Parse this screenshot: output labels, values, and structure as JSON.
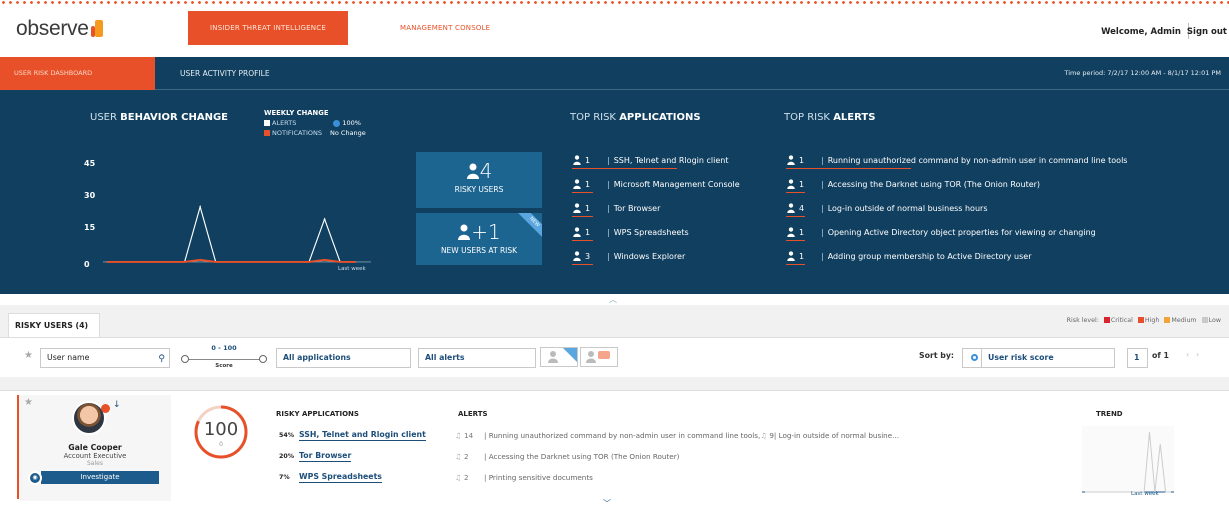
{
  "header": {
    "logo_text": "observe",
    "nav_active": "INSIDER THREAT INTELLIGENCE",
    "nav_link": "MANAGEMENT CONSOLE",
    "welcome": "Welcome, Admin",
    "signout": "Sign out"
  },
  "subnav": {
    "active": "USER RISK DASHBOARD",
    "link": "USER ACTIVITY PROFILE",
    "time_period": "Time period: 7/2/17 12:00 AM - 8/1/17 12:01 PM"
  },
  "behavior": {
    "title_light": "USER",
    "title_bold": "BEHAVIOR CHANGE",
    "weekly_title": "WEEKLY CHANGE",
    "alerts_label": "ALERTS",
    "alerts_change": "100%",
    "notif_label": "NOTIFICATIONS",
    "notif_change": "No Change",
    "y_ticks": [
      "45",
      "30",
      "15",
      "0"
    ],
    "x_label": "Last week"
  },
  "chart_data": {
    "type": "line",
    "yticks": [
      0,
      15,
      30,
      45
    ],
    "ylim": [
      0,
      45
    ],
    "xlabel": "Last week",
    "series": [
      {
        "name": "ALERTS",
        "color": "#ffffff",
        "values": [
          0,
          0,
          0,
          0,
          0,
          0,
          27,
          0,
          0,
          0,
          0,
          0,
          0,
          0,
          21,
          0,
          0
        ]
      },
      {
        "name": "NOTIFICATIONS",
        "color": "#e8502a",
        "values": [
          0,
          0,
          0,
          0,
          0,
          0,
          1,
          0,
          0,
          0,
          0,
          0,
          0,
          0,
          1,
          0,
          0
        ]
      }
    ]
  },
  "cards": {
    "risky_users_value": "4",
    "risky_users_label": "RISKY USERS",
    "new_users_value": "+1",
    "new_users_label": "NEW USERS AT RISK",
    "new_badge": "NEW"
  },
  "top_apps": {
    "title_light": "TOP RISK",
    "title_bold": "APPLICATIONS",
    "items": [
      {
        "count": "1",
        "name": "SSH, Telnet and Rlogin client",
        "bar": 0.55
      },
      {
        "count": "1",
        "name": "Microsoft Management Console",
        "bar": 0.11
      },
      {
        "count": "1",
        "name": "Tor Browser",
        "bar": 0.11
      },
      {
        "count": "1",
        "name": "WPS Spreadsheets",
        "bar": 0.11
      },
      {
        "count": "3",
        "name": "Windows Explorer",
        "bar": 0.11
      }
    ]
  },
  "top_alerts": {
    "title_light": "TOP RISK",
    "title_bold": "ALERTS",
    "items": [
      {
        "count": "1",
        "name": "Running unauthorized command by non-admin user in command line tools",
        "bar": 0.33
      },
      {
        "count": "1",
        "name": "Accessing the Darknet using TOR (The Onion Router)",
        "bar": 0.05
      },
      {
        "count": "4",
        "name": "Log-in outside of normal business hours",
        "bar": 0.05
      },
      {
        "count": "1",
        "name": "Opening Active Directory object properties for viewing or changing",
        "bar": 0.05
      },
      {
        "count": "1",
        "name": "Adding group membership to Active Directory user",
        "bar": 0.05
      }
    ]
  },
  "risky_users": {
    "tab_label": "RISKY USERS (4)",
    "risk_level_label": "Risk level:",
    "levels": [
      {
        "name": "Critical",
        "color": "#d9232d"
      },
      {
        "name": "High",
        "color": "#e8502a"
      },
      {
        "name": "Medium",
        "color": "#f2a33a"
      },
      {
        "name": "Low",
        "color": "#c9c9c9"
      }
    ],
    "filters": {
      "user_placeholder": "User name",
      "score_range": "0 - 100",
      "score_label": "Score",
      "apps_value": "All applications",
      "alerts_value": "All alerts",
      "sort_label": "Sort by:",
      "sort_value": "User risk score",
      "page": "1",
      "page_of": "of 1",
      "score_min": 0,
      "score_max": 100
    },
    "user": {
      "name": "Gale Cooper",
      "role": "Account Executive",
      "dept": "Sales",
      "investigate": "Investigate",
      "score": "100",
      "score_sub": "0",
      "score_fraction": 0.82,
      "risky_apps_title": "RISKY APPLICATIONS",
      "apps": [
        {
          "pct": "54%",
          "name": "SSH, Telnet and Rlogin client"
        },
        {
          "pct": "20%",
          "name": "Tor Browser"
        },
        {
          "pct": "7%",
          "name": "WPS Spreadsheets"
        }
      ],
      "alerts_title": "ALERTS",
      "alerts": [
        {
          "count": "14",
          "text": "Running unauthorized command by non-admin user in command line tools,",
          "extra": "9",
          "extra_text": "Log-in outside of normal busine..."
        },
        {
          "count": "2",
          "text": "Accessing the Darknet using TOR (The Onion Router)",
          "extra": "",
          "extra_text": ""
        },
        {
          "count": "2",
          "text": "Printing sensitive documents",
          "extra": "",
          "extra_text": ""
        }
      ],
      "trend_title": "TREND",
      "trend_label": "Last week",
      "trend_values": [
        0,
        0,
        0,
        0,
        0,
        0,
        0,
        0,
        0,
        0,
        0,
        0,
        5,
        0,
        4,
        0,
        0
      ]
    }
  }
}
